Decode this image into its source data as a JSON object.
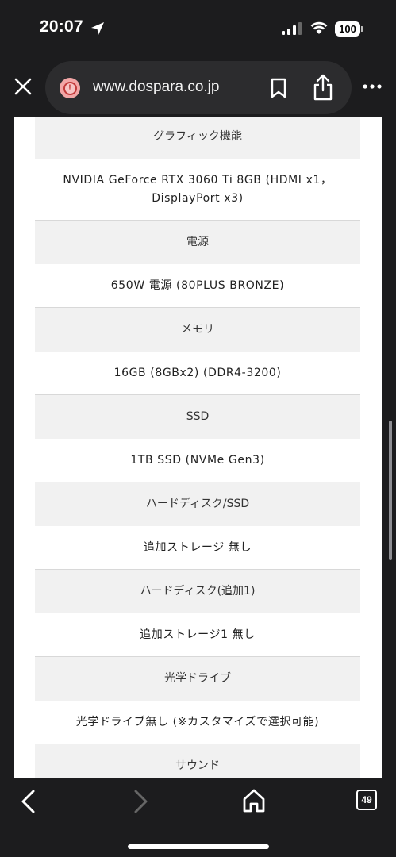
{
  "status_bar": {
    "time": "20:07",
    "battery": "100"
  },
  "browser": {
    "url": "www.dospara.co.jp",
    "tab_count": "49"
  },
  "specs": [
    {
      "label": "グラフィック機能",
      "value": "NVIDIA GeForce RTX 3060 Ti 8GB (HDMI x1，\nDisplayPort x3)"
    },
    {
      "label": "電源",
      "value": "650W 電源 (80PLUS BRONZE)"
    },
    {
      "label": "メモリ",
      "value": "16GB (8GBx2) (DDR4-3200)"
    },
    {
      "label": "SSD",
      "value": "1TB SSD (NVMe Gen3)"
    },
    {
      "label": "ハードディスク/SSD",
      "value": "追加ストレージ 無し"
    },
    {
      "label": "ハードディスク(追加1)",
      "value": "追加ストレージ1 無し"
    },
    {
      "label": "光学ドライブ",
      "value": "光学ドライブ無し (※カスタマイズで選択可能)"
    },
    {
      "label": "サウンド",
      "value": ""
    }
  ],
  "icons": {
    "status": [
      "location-arrow-icon",
      "signal-icon",
      "wifi-icon",
      "battery-icon"
    ],
    "toolbar": [
      "close-icon",
      "alert-icon",
      "bookmark-icon",
      "share-icon",
      "more-icon"
    ],
    "bottom": [
      "back-icon",
      "forward-icon",
      "home-icon",
      "tabs-icon"
    ]
  },
  "colors": {
    "chrome_background": "#1c1c1e",
    "url_pill": "#2c2c2e",
    "label_row_bg": "#f1f1f1",
    "alert_red": "#c23a3a"
  }
}
